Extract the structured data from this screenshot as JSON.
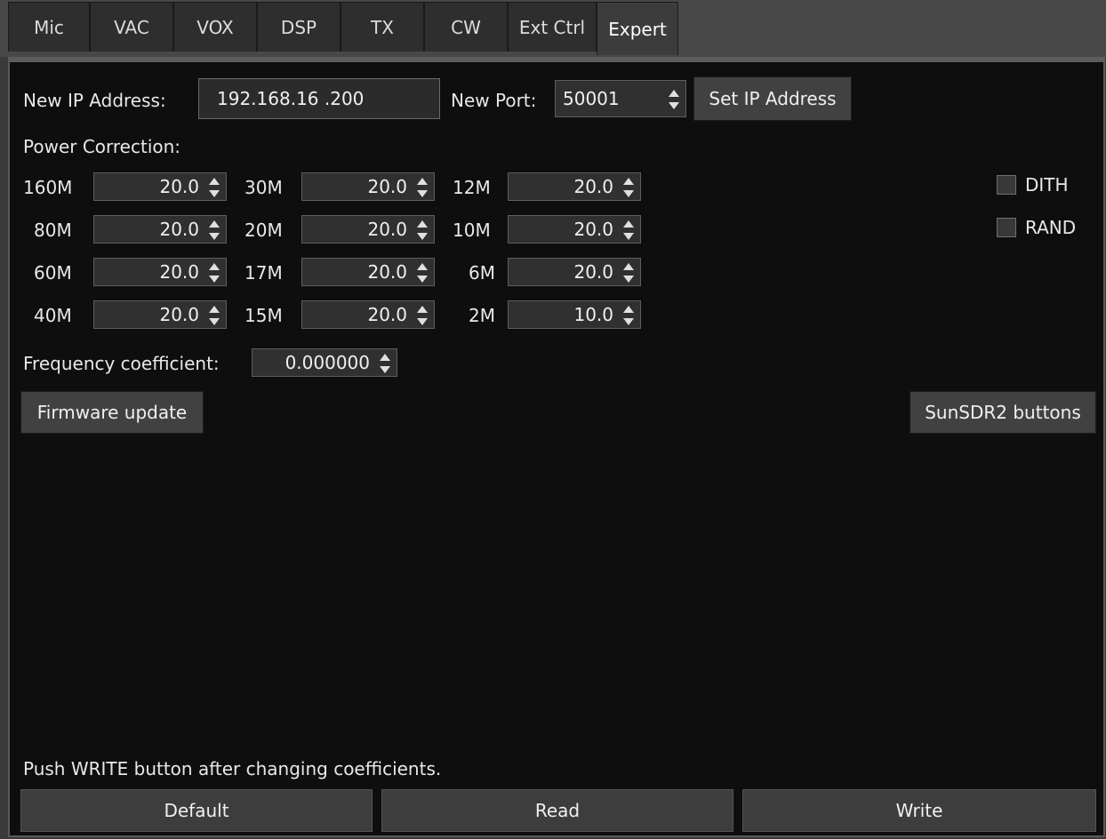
{
  "tabs": [
    {
      "label": "Mic"
    },
    {
      "label": "VAC"
    },
    {
      "label": "VOX"
    },
    {
      "label": "DSP"
    },
    {
      "label": "TX"
    },
    {
      "label": "CW"
    },
    {
      "label": "Ext Ctrl"
    },
    {
      "label": "Expert",
      "active": true
    }
  ],
  "network": {
    "ip_label": "New IP Address:",
    "ip_value": "192.168.16 .200",
    "port_label": "New Port:",
    "port_value": "50001",
    "set_ip_button": "Set IP Address"
  },
  "power_correction": {
    "title": "Power Correction:",
    "bands": [
      {
        "band": "160M",
        "value": "20.0"
      },
      {
        "band": "80M",
        "value": "20.0"
      },
      {
        "band": "60M",
        "value": "20.0"
      },
      {
        "band": "40M",
        "value": "20.0"
      },
      {
        "band": "30M",
        "value": "20.0"
      },
      {
        "band": "20M",
        "value": "20.0"
      },
      {
        "band": "17M",
        "value": "20.0"
      },
      {
        "band": "15M",
        "value": "20.0"
      },
      {
        "band": "12M",
        "value": "20.0"
      },
      {
        "band": "10M",
        "value": "20.0"
      },
      {
        "band": "6M",
        "value": "20.0"
      },
      {
        "band": "2M",
        "value": "10.0"
      }
    ]
  },
  "options": {
    "dith_label": "DITH",
    "dith_checked": false,
    "rand_label": "RAND",
    "rand_checked": false
  },
  "frequency": {
    "label": "Frequency coefficient:",
    "value": "0.000000"
  },
  "buttons": {
    "firmware_update": "Firmware update",
    "sunsdr2_buttons": "SunSDR2 buttons",
    "default": "Default",
    "read": "Read",
    "write": "Write"
  },
  "hint": "Push WRITE button after changing coefficients."
}
